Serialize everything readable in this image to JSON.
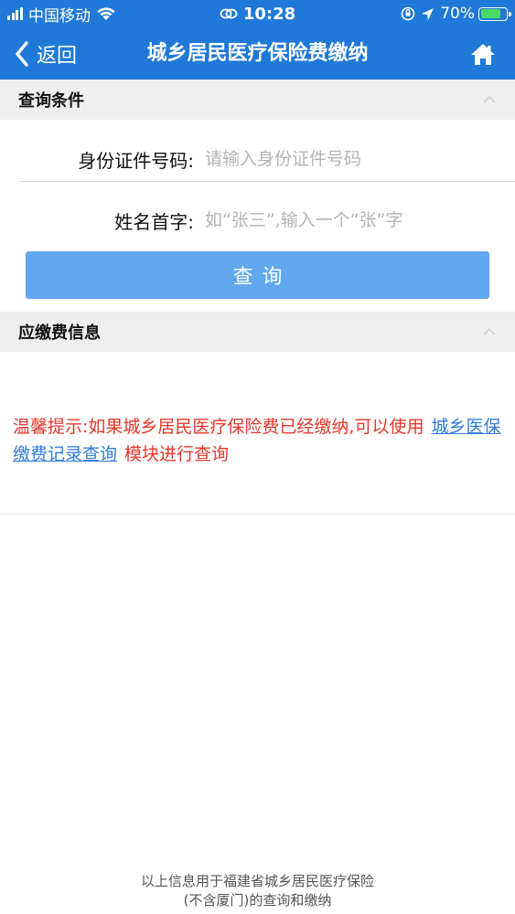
{
  "status_bar": {
    "carrier": "中国移动",
    "time": "10:28",
    "battery": "70%"
  },
  "nav": {
    "back_label": "返回",
    "title": "城乡居民医疗保险费缴纳"
  },
  "query_section": {
    "title": "查询条件",
    "id_label": "身份证件号码:",
    "id_placeholder": "请输入身份证件号码",
    "name_label": "姓名首字:",
    "name_placeholder": "如“张三”,输入一个“张”字",
    "query_button": "查询"
  },
  "payment_section": {
    "title": "应缴费信息",
    "tip_prefix": "温馨提示:如果城乡居民医疗保险费已经缴纳,可以使用",
    "tip_link": "城乡医保缴费记录查询",
    "tip_suffix": "模块进行查询"
  },
  "footer": {
    "line1": "以上信息用于福建省城乡居民医疗保险",
    "line2": "(不含厦门)的查询和缴纳"
  },
  "colors": {
    "primary": "#1f79d8",
    "button": "#62a8ef",
    "tip_text": "#e6372a",
    "link": "#2f7ce0"
  },
  "icons": {
    "back": "chevron-left-icon",
    "home": "home-icon",
    "collapse": "chevron-up-icon"
  }
}
